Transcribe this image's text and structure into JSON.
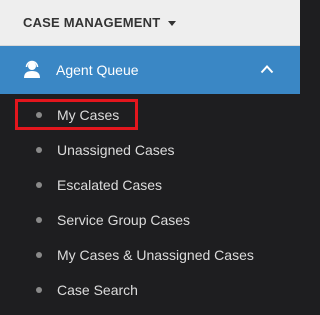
{
  "header": {
    "title": "CASE MANAGEMENT",
    "dropdown_icon": "caret-down-icon"
  },
  "group": {
    "title": "Agent Queue",
    "icon": "agent-headset-icon",
    "toggle_icon": "chevron-up-icon",
    "expanded": true
  },
  "menu": {
    "items": [
      {
        "label": "My Cases",
        "highlighted": true
      },
      {
        "label": "Unassigned Cases"
      },
      {
        "label": "Escalated Cases"
      },
      {
        "label": "Service Group Cases"
      },
      {
        "label": "My Cases & Unassigned Cases"
      },
      {
        "label": "Case Search"
      }
    ]
  },
  "colors": {
    "header_bg": "#eeeeee",
    "header_text": "#333333",
    "group_bg": "#3a87c5",
    "panel_bg": "#1e1e20",
    "item_text": "#dcdcdc",
    "bullet": "#8a8a8a",
    "highlight": "#e3161d"
  }
}
